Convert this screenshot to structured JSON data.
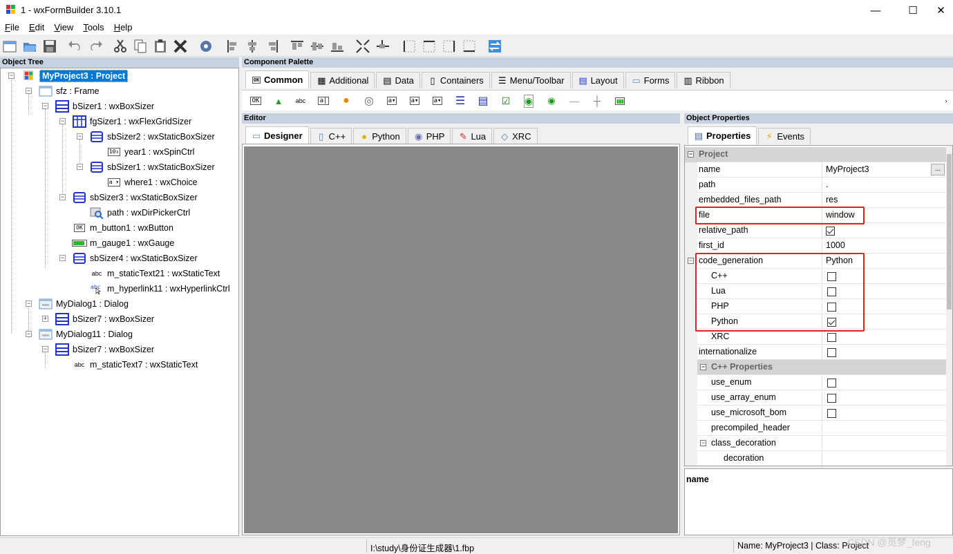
{
  "window": {
    "title": "1 - wxFormBuilder 3.10.1",
    "minimize_glyph": "—",
    "maximize_glyph": "☐",
    "close_glyph": "✕"
  },
  "menu": [
    {
      "accel": "F",
      "rest": "ile"
    },
    {
      "accel": "E",
      "rest": "dit"
    },
    {
      "accel": "V",
      "rest": "iew"
    },
    {
      "accel": "T",
      "rest": "ools"
    },
    {
      "accel": "H",
      "rest": "elp"
    }
  ],
  "panels": {
    "object_tree": "Object Tree",
    "component_palette": "Component Palette",
    "editor": "Editor",
    "object_properties": "Object Properties"
  },
  "tree": [
    {
      "label": "MyProject3 : Project",
      "icon": "project-icon"
    },
    {
      "label": "sfz : Frame",
      "icon": "frame-icon"
    },
    {
      "label": "bSizer1 : wxBoxSizer",
      "icon": "boxsizer-icon"
    },
    {
      "label": "fgSizer1 : wxFlexGridSizer",
      "icon": "flexgridsizer-icon"
    },
    {
      "label": "sbSizer2 : wxStaticBoxSizer",
      "icon": "staticboxsizer-icon"
    },
    {
      "label": "year1 : wxSpinCtrl",
      "icon": "spinctrl-icon"
    },
    {
      "label": "sbSizer1 : wxStaticBoxSizer",
      "icon": "staticboxsizer-icon"
    },
    {
      "label": "where1 : wxChoice",
      "icon": "choice-icon"
    },
    {
      "label": "sbSizer3 : wxStaticBoxSizer",
      "icon": "staticboxsizer-icon"
    },
    {
      "label": "path : wxDirPickerCtrl",
      "icon": "dirpicker-icon"
    },
    {
      "label": "m_button1 : wxButton",
      "icon": "button-icon"
    },
    {
      "label": "m_gauge1 : wxGauge",
      "icon": "gauge-icon"
    },
    {
      "label": "sbSizer4 : wxStaticBoxSizer",
      "icon": "staticboxsizer-icon"
    },
    {
      "label": "m_staticText21 : wxStaticText",
      "icon": "statictext-icon"
    },
    {
      "label": "m_hyperlink11 : wxHyperlinkCtrl",
      "icon": "hyperlink-icon"
    },
    {
      "label": "MyDialog1 : Dialog",
      "icon": "dialog-icon"
    },
    {
      "label": "bSizer7 : wxBoxSizer",
      "icon": "boxsizer-icon"
    },
    {
      "label": "MyDialog11 : Dialog",
      "icon": "dialog-icon"
    },
    {
      "label": "bSizer7 : wxBoxSizer",
      "icon": "boxsizer-icon"
    },
    {
      "label": "m_staticText7 : wxStaticText",
      "icon": "statictext-icon"
    }
  ],
  "tree_glyphs": {
    "spin": "10⇕",
    "choice": "a ▾",
    "button": "OK",
    "text": "abc"
  },
  "palette_tabs": [
    {
      "label": "Common",
      "icon": "ok-button-icon"
    },
    {
      "label": "Additional",
      "icon": "additional-icon"
    },
    {
      "label": "Data",
      "icon": "data-icon"
    },
    {
      "label": "Containers",
      "icon": "containers-icon"
    },
    {
      "label": "Menu/Toolbar",
      "icon": "menu-toolbar-icon"
    },
    {
      "label": "Layout",
      "icon": "layout-icon"
    },
    {
      "label": "Forms",
      "icon": "forms-icon"
    },
    {
      "label": "Ribbon",
      "icon": "ribbon-icon"
    }
  ],
  "palette_items": [
    {
      "name": "button-icon",
      "glyph": "OK"
    },
    {
      "name": "bitmap-button-icon",
      "glyph": "▲"
    },
    {
      "name": "static-text-icon",
      "glyph": "abc"
    },
    {
      "name": "text-ctrl-icon",
      "glyph": "a|"
    },
    {
      "name": "static-bitmap-icon",
      "glyph": "●"
    },
    {
      "name": "combo-box-icon",
      "glyph": "◎"
    },
    {
      "name": "choice-icon",
      "glyph": "a▾"
    },
    {
      "name": "list-box-icon",
      "glyph": "a▾"
    },
    {
      "name": "bitmap-combo-icon",
      "glyph": "a▾"
    },
    {
      "name": "list-ctrl-icon",
      "glyph": "☰"
    },
    {
      "name": "grid-icon",
      "glyph": "▤"
    },
    {
      "name": "checkbox-icon",
      "glyph": "☑"
    },
    {
      "name": "radio-box-icon",
      "glyph": "◉"
    },
    {
      "name": "radio-button-icon",
      "glyph": "◉"
    },
    {
      "name": "static-line-icon",
      "glyph": "—"
    },
    {
      "name": "slider-icon",
      "glyph": "┼"
    },
    {
      "name": "gauge-icon",
      "glyph": "▮▮▮"
    }
  ],
  "palette_overflow": "›",
  "editor_tabs": [
    {
      "label": "Designer",
      "icon": "designer-icon"
    },
    {
      "label": "C++",
      "icon": "cpp-icon"
    },
    {
      "label": "Python",
      "icon": "python-icon"
    },
    {
      "label": "PHP",
      "icon": "php-icon"
    },
    {
      "label": "Lua",
      "icon": "lua-icon"
    },
    {
      "label": "XRC",
      "icon": "xrc-icon"
    }
  ],
  "prop_tabs": [
    {
      "label": "Properties",
      "icon": "properties-icon"
    },
    {
      "label": "Events",
      "icon": "events-icon"
    }
  ],
  "properties": {
    "cat_project": "Project",
    "name_k": "name",
    "name_v": "MyProject3",
    "name_btn": "...",
    "path_k": "path",
    "path_v": ".",
    "emb_k": "embedded_files_path",
    "emb_v": "res",
    "file_k": "file",
    "file_v": "window",
    "rel_k": "relative_path",
    "rel_v": true,
    "first_k": "first_id",
    "first_v": "1000",
    "code_k": "code_generation",
    "code_v": "Python",
    "cpp_k": "C++",
    "cpp_v": false,
    "lua_k": "Lua",
    "lua_v": false,
    "php_k": "PHP",
    "php_v": false,
    "py_k": "Python",
    "py_v": true,
    "xrc_k": "XRC",
    "xrc_v": false,
    "intl_k": "internationalize",
    "intl_v": false,
    "cat_cpp": "C++ Properties",
    "enum_k": "use_enum",
    "enum_v": false,
    "arr_k": "use_array_enum",
    "arr_v": false,
    "ms_k": "use_microsoft_bom",
    "ms_v": false,
    "pch_k": "precompiled_header",
    "cls_k": "class_decoration",
    "dec_k": "decoration"
  },
  "description": {
    "title": "name"
  },
  "status": {
    "path": "I:\\study\\身份证生成器\\1.fbp",
    "info": "Name: MyProject3 | Class: Project"
  },
  "watermark": "CSDN @觅梦_feng",
  "colors": {
    "selection": "#0078d7",
    "highlight_box": "#e0201c",
    "editor_canvas": "#888888",
    "panel_header": "#c7d3e1"
  }
}
